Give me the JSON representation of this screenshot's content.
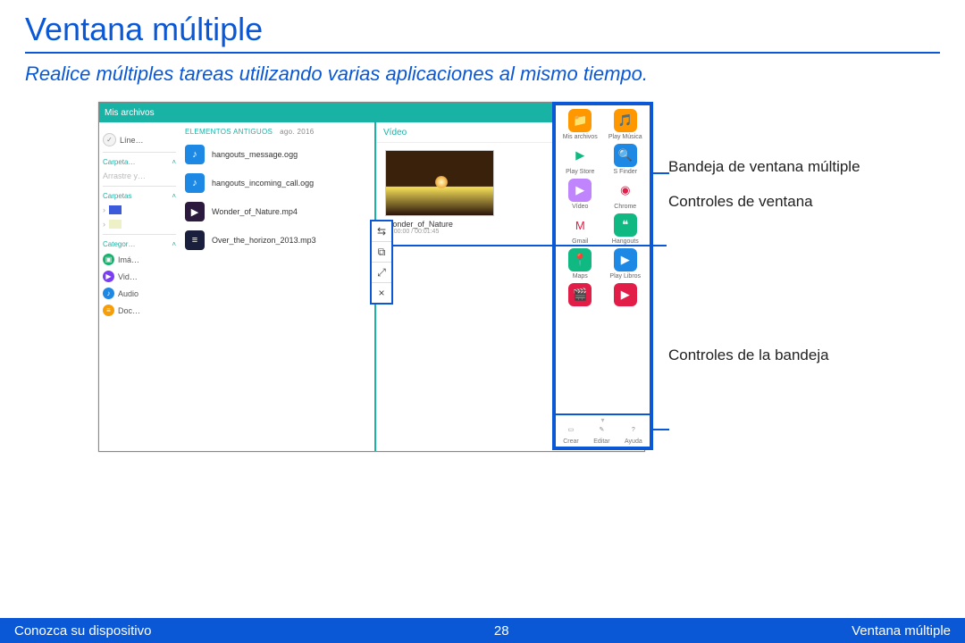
{
  "doc": {
    "title": "Ventana múltiple",
    "subtitle": "Realice múltiples tareas utilizando varias aplicaciones al mismo tiempo."
  },
  "footer": {
    "left": "Conozca su dispositivo",
    "page": "28",
    "right": "Ventana múltiple"
  },
  "callouts": {
    "tray": "Bandeja de ventana múltiple",
    "controls": "Controles de ventana",
    "tray_controls": "Controles de la bandeja"
  },
  "device": {
    "topbar_title": "Mis archivos",
    "topbar_icons": [
      "grid-icon",
      "globe-icon",
      "search-icon",
      "more-icon"
    ],
    "sidebar": {
      "timeline_label": "Líne…",
      "carpeta_hdr": "Carpeta…",
      "arrastre": "Arrastre y…",
      "carpetas_hdr": "Carpetas",
      "categor_hdr": "Categor…",
      "cats": [
        {
          "name": "Imá…",
          "color": "#19b36f",
          "glyph": "▣"
        },
        {
          "name": "Vid…",
          "color": "#7b3ff2",
          "glyph": "▶"
        },
        {
          "name": "Audio",
          "color": "#1e88e5",
          "glyph": "♪"
        },
        {
          "name": "Doc…",
          "color": "#f59e0b",
          "glyph": "≡"
        }
      ],
      "caret": "˄",
      "folder_caret": "›"
    },
    "filelist": {
      "header": "ELEMENTOS ANTIGUOS",
      "date": "ago. 2016",
      "rows": [
        {
          "name": "hangouts_message.ogg",
          "color": "#1e88e5",
          "glyph": "♪"
        },
        {
          "name": "hangouts_incoming_call.ogg",
          "color": "#1e88e5",
          "glyph": "♪"
        },
        {
          "name": "Wonder_of_Nature.mp4",
          "color": "#2b1a3d",
          "glyph": "▶"
        },
        {
          "name": "Over_the_horizon_2013.mp3",
          "color": "#1a1f3d",
          "glyph": "≡"
        }
      ]
    },
    "midpane": {
      "header": "Vídeo",
      "video_name": "Wonder_of_Nature",
      "video_time": "00:00:00 / 00:01:45"
    },
    "window_controls": [
      "⇆",
      "⧉",
      "⤢",
      "×"
    ]
  },
  "tray": {
    "apps": [
      {
        "name": "Mis archivos",
        "color": "#ff9800",
        "initial": "📁"
      },
      {
        "name": "Play Música",
        "color": "#ff9800",
        "initial": "🎵"
      },
      {
        "name": "Play Store",
        "color": "#ffffff",
        "initial": "▶",
        "fg": "#10b981"
      },
      {
        "name": "S Finder",
        "color": "#1e88e5",
        "initial": "🔍"
      },
      {
        "name": "Vídeo",
        "color": "#c084fc",
        "initial": "▶"
      },
      {
        "name": "Chrome",
        "color": "#ffffff",
        "initial": "◉",
        "fg": "#e11d48"
      },
      {
        "name": "Gmail",
        "color": "#ffffff",
        "initial": "M",
        "fg": "#e11d48"
      },
      {
        "name": "Hangouts",
        "color": "#10b981",
        "initial": "❝"
      },
      {
        "name": "Maps",
        "color": "#10b981",
        "initial": "📍"
      },
      {
        "name": "Play Libros",
        "color": "#1e88e5",
        "initial": "▶"
      },
      {
        "name": "",
        "color": "#e11d48",
        "initial": "🎬"
      },
      {
        "name": "",
        "color": "#e11d48",
        "initial": "▶"
      }
    ],
    "bottom": [
      {
        "label": "Crear",
        "glyph": "▭"
      },
      {
        "label": "Editar",
        "glyph": "✎"
      },
      {
        "label": "Ayuda",
        "glyph": "?"
      }
    ]
  }
}
